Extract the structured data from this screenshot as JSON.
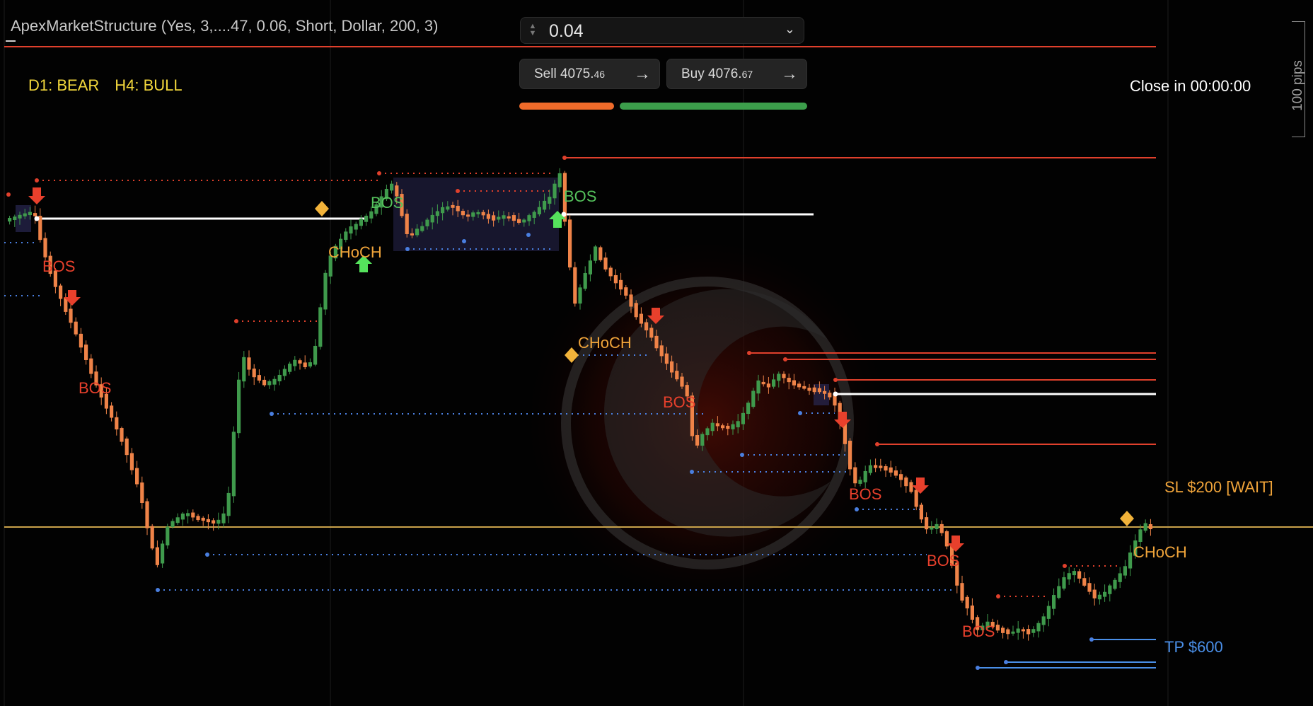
{
  "indicator": {
    "title": "ApexMarketStructure (Yes, 3,....47, 0.06, Short, Dollar, 200, 3)"
  },
  "bias": {
    "d1": "D1: BEAR",
    "h4": "H4: BULL"
  },
  "timer": {
    "close_in": "Close in 00:00:00"
  },
  "trade_panel": {
    "lot_size": "0.04",
    "sell": {
      "label": "Sell",
      "price_main": "4075.",
      "price_frac": "46"
    },
    "buy": {
      "label": "Buy",
      "price_main": "4076.",
      "price_frac": "67"
    }
  },
  "scale": {
    "pips_label": "100 pips"
  },
  "orders": {
    "sl_label": "SL $200  [WAIT]",
    "tp_label": "TP $600"
  },
  "structure_labels": {
    "bos_bull_1": "BOS",
    "bos_bull_2": "BOS",
    "choch_bull_1": "CHoCH",
    "choch_bull_2": "CHoCH",
    "choch_bull_3": "CHoCH",
    "bos_bear_1": "BOS",
    "bos_bear_2": "BOS",
    "bos_bear_3": "BOS",
    "bos_bear_4": "BOS",
    "bos_bear_5": "BOS",
    "bos_bear_6": "BOS"
  },
  "colors": {
    "bull_candle": "#3f9a4c",
    "bear_candle": "#ef8348",
    "bear_label": "#e8402c",
    "bull_label": "#55c25c",
    "choch_label": "#f0a43a",
    "sl_line": "#c9a24a",
    "tp_line": "#4a8fe8",
    "resistance_line": "#e0402c",
    "support_dots": "#4a7fe0"
  },
  "icons": {
    "lot_stepper": "stepper-icon",
    "dropdown": "chevron-down-icon",
    "trade_arrow": "arrow-right-icon"
  }
}
